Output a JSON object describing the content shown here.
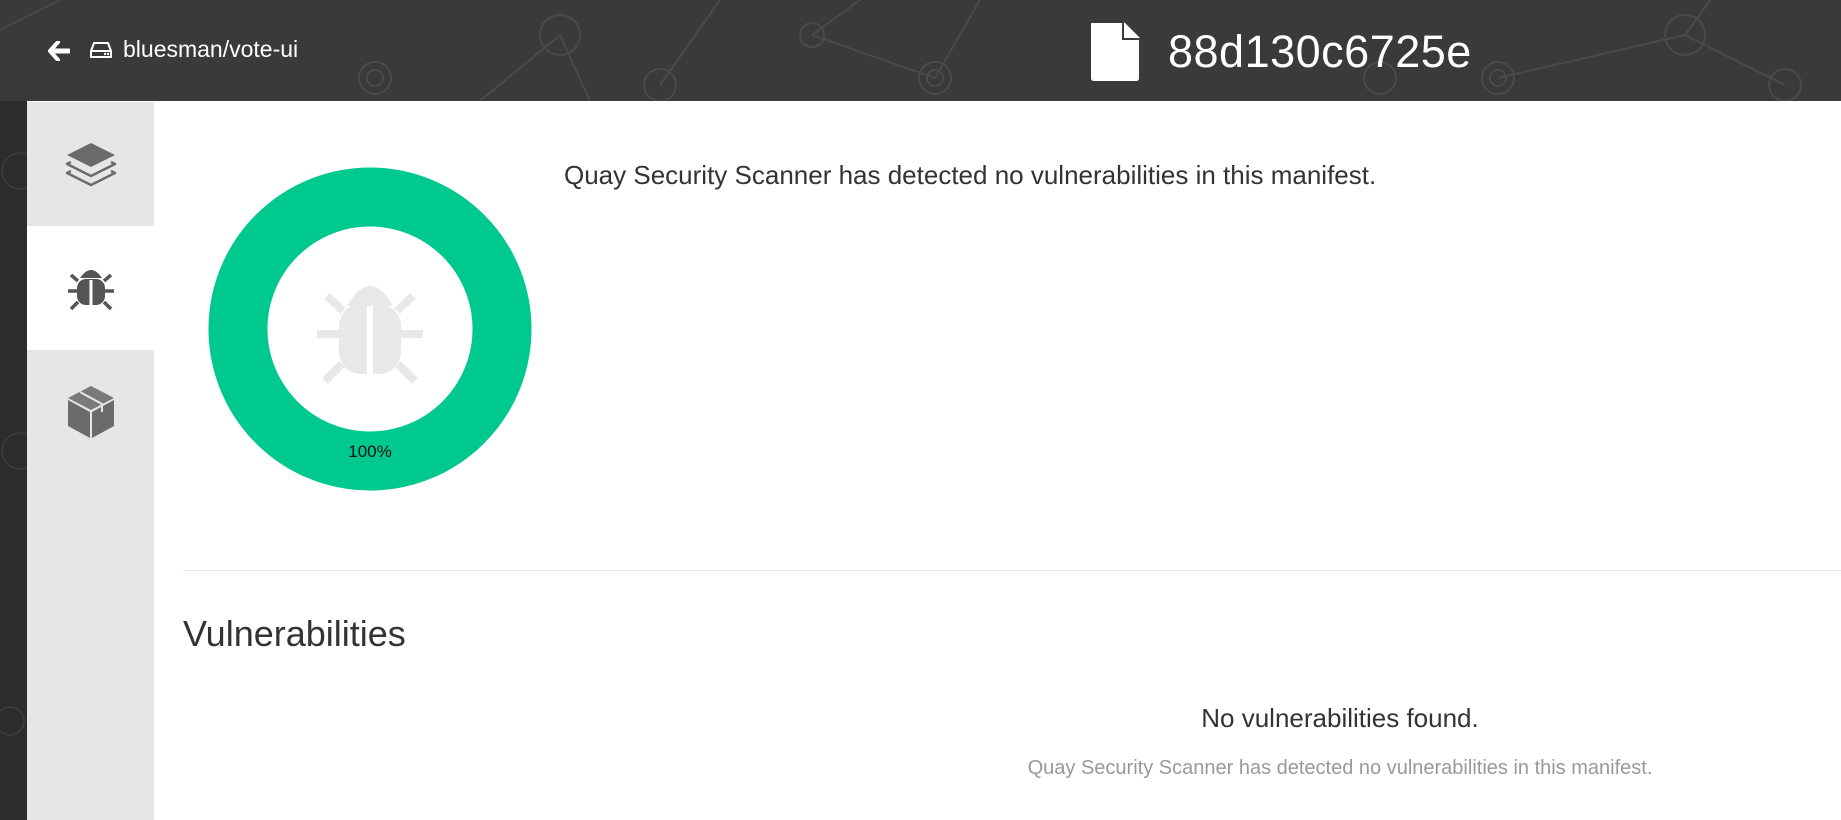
{
  "header": {
    "repository": "bluesman/vote-ui",
    "manifest_digest": "88d130c6725e"
  },
  "sidebar": {
    "items": [
      {
        "name": "layers",
        "icon": "layers-icon",
        "active": false
      },
      {
        "name": "security",
        "icon": "bug-icon",
        "active": true
      },
      {
        "name": "packages",
        "icon": "package-box-icon",
        "active": false
      }
    ]
  },
  "security_summary": {
    "message": "Quay Security Scanner has detected no vulnerabilities in this manifest.",
    "donut_percent_label": "100%",
    "donut_fraction": 1.0,
    "donut_color": "#00c98f"
  },
  "vulnerabilities": {
    "section_title": "Vulnerabilities",
    "empty_title": "No vulnerabilities found.",
    "empty_message": "Quay Security Scanner has detected no vulnerabilities in this manifest."
  },
  "colors": {
    "header_bg": "#3a3a3a",
    "sidebar_bg": "#e6e6e6",
    "accent_green": "#00c98f"
  }
}
